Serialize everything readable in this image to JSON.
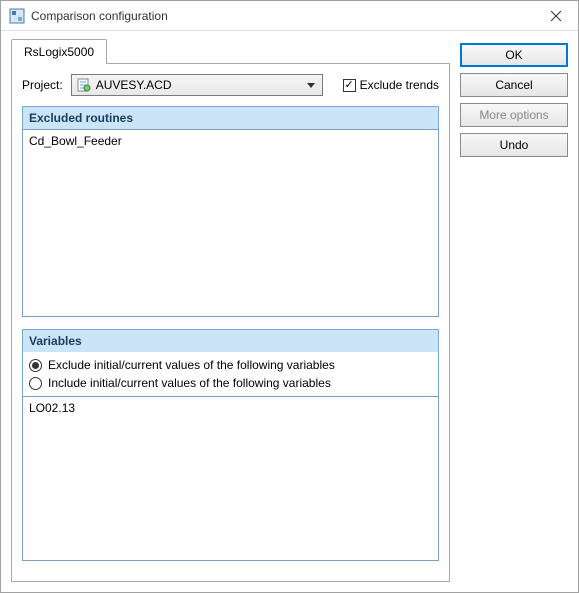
{
  "window": {
    "title": "Comparison configuration"
  },
  "tab": {
    "label": "RsLogix5000"
  },
  "project": {
    "label": "Project:",
    "value": "AUVESY.ACD"
  },
  "excludeTrends": {
    "label": "Exclude trends",
    "checked": true
  },
  "section1": {
    "title": "Excluded routines",
    "items": [
      "Cd_Bowl_Feeder"
    ]
  },
  "section2": {
    "title": "Variables",
    "radios": {
      "exclude": "Exclude initial/current values of the following variables",
      "include": "Include initial/current values of the following variables",
      "selected": "exclude"
    },
    "items": [
      "LO02.13"
    ]
  },
  "buttons": {
    "ok": "OK",
    "cancel": "Cancel",
    "more": "More options",
    "undo": "Undo"
  }
}
